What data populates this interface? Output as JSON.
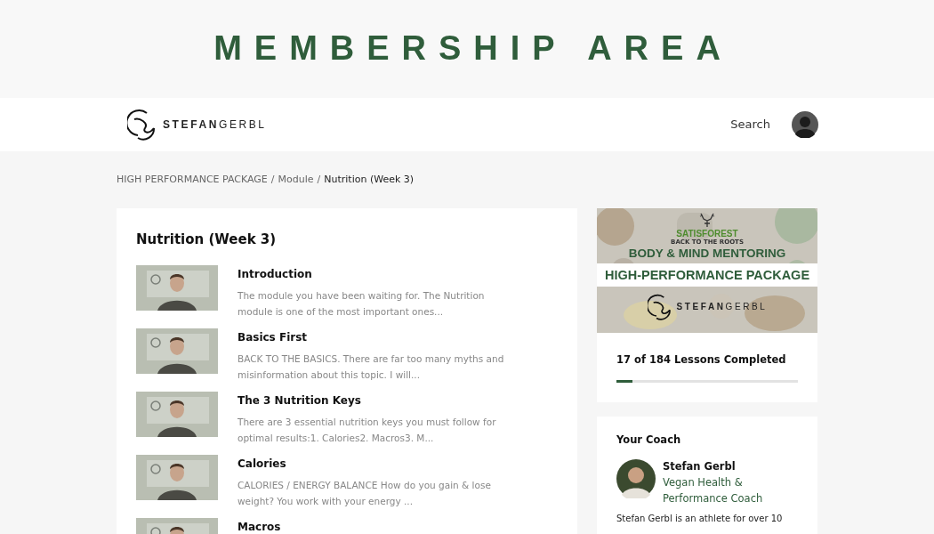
{
  "page_title": "MEMBERSHIP AREA",
  "navbar": {
    "logo": "**STEFAN**GERBL",
    "search": "Search"
  },
  "breadcrumb": [
    {
      "label": "HIGH PERFORMANCE PACKAGE",
      "current": false
    },
    {
      "label": "Module",
      "current": false
    },
    {
      "label": "Nutrition (Week 3)",
      "current": true
    }
  ],
  "breadcrumb_separator": "/",
  "module": {
    "title": "Nutrition (Week 3)",
    "lessons": [
      {
        "title": "Introduction",
        "description": "The module you have been waiting for. The Nutrition module is one of the most important ones..."
      },
      {
        "title": "Basics First",
        "description": "BACK TO THE BASICS. There are far too many myths and misinformation about this topic. I will..."
      },
      {
        "title": "The 3 Nutrition Keys",
        "description": "There are 3 essential nutrition keys you must follow for optimal results:1. Calories2. Macros3. M..."
      },
      {
        "title": "Calories",
        "description": "CALORIES / ENERGY BALANCE How do you gain & lose weight? You work with your energy ..."
      },
      {
        "title": "Macros"
      }
    ]
  },
  "course": {
    "banner": {
      "brand": "SATISFOREST",
      "tagline": "BACK TO THE ROOTS",
      "headline": "BODY & MIND MENTORING",
      "package": "HIGH-PERFORMANCE PACKAGE",
      "logo": "**STEFAN**GERBL"
    },
    "progress_text": "17 of 184 Lessons Completed",
    "level": 0.09
  },
  "coach": {
    "heading": "Your Coach",
    "name": "Stefan Gerbl",
    "role": "Vegan Health & Performance Coach",
    "bio": "Stefan Gerbl is an athlete for over 10"
  }
}
